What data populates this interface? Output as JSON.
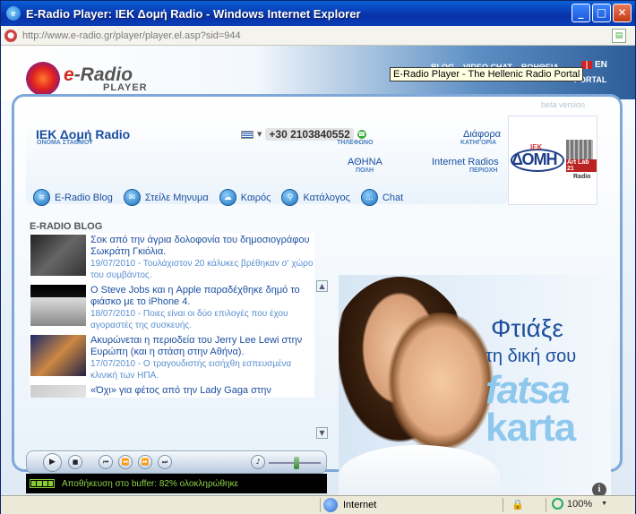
{
  "window": {
    "title": "E-Radio Player: ΙΕΚ Δομή Radio - Windows Internet Explorer",
    "address": "http://www.e-radio.gr/player/player.el.asp?sid=944",
    "minimize": "_",
    "maximize": "□",
    "close": "✕"
  },
  "site": {
    "logo_main": "-Radio",
    "logo_e": "e",
    "logo_sub": "PLAYER",
    "topnav": [
      "BLOG",
      "VIDEO CHAT",
      "ΒΟΗΘΕΙΑ"
    ],
    "lang": "EN",
    "portal": "PORTAL",
    "tooltip": "E-Radio Player - The Hellenic Radio Portal",
    "beta": "beta version"
  },
  "station": {
    "name": "ΙΕΚ Δομή Radio",
    "name_label": "ΟΝΟΜΑ ΣΤΑΘΜΟΥ",
    "phone": "+30 2103840552",
    "phone_label": "ΤΗΛΕΦΩΝΟ",
    "category": "Διάφορα",
    "category_label": "ΚΑΤΗΓΟΡΙΑ",
    "city": "ΑΘΗΝΑ",
    "city_label": "ΠΟΛΗ",
    "region": "Internet Radios",
    "region_label": "ΠΕΡΙΟΧΗ",
    "logo_iek": "ΙΕΚ",
    "logo_domi": "ΔΟΜΗ",
    "logo_art": "Art Lab 21",
    "logo_radio": "Radio"
  },
  "menu": [
    {
      "label": "E-Radio Blog",
      "icon": "blog-icon"
    },
    {
      "label": "Στείλε Μηνυμα",
      "icon": "mail-icon"
    },
    {
      "label": "Καιρός",
      "icon": "weather-icon"
    },
    {
      "label": "Κατάλογος",
      "icon": "search-icon"
    },
    {
      "label": "Chat",
      "icon": "chat-icon"
    }
  ],
  "blog": {
    "title": "E-RADIO BLOG",
    "posts": [
      {
        "title": "Σοκ από την άγρια δολοφονία του δημοσιογράφου Σωκράτη Γκιόλια.",
        "meta": "19/07/2010 - Τουλάχιστον 20 κάλυκες βρέθηκαν σ' χώρο του συμβάντος."
      },
      {
        "title": "Ο Steve Jobs και η Apple παραδέχθηκε δημό το φιάσκο με το iPhone 4.",
        "meta": "18/07/2010 - Ποιες είναι οι δύο επιλογές που έχου αγοραστές της συσκευής."
      },
      {
        "title": "Ακυρώνεται η περιοδεία του Jerry Lee Lewi στην Ευρώπη (και η στάση στην Αθήνα).",
        "meta": "17/07/2010 - Ο τραγουδιστής εισήχθη εσπευσμένα κλινική των ΗΠΑ."
      },
      {
        "title": "«Όχι» για φέτος από την Lady Gaga στην",
        "meta": ""
      }
    ]
  },
  "player": {
    "buffer_text": "Αποθήκευση στο buffer: 82% ολοκληρώθηκε",
    "buffer_progress": 0.82,
    "volume_level": 0.5
  },
  "ad": {
    "line1": "Φτιάξε",
    "line2": "τη δική σου",
    "brand1": "fatsa",
    "brand2": "karta",
    "info": "i"
  },
  "statusbar": {
    "zone": "Internet",
    "zoom": "100%"
  }
}
